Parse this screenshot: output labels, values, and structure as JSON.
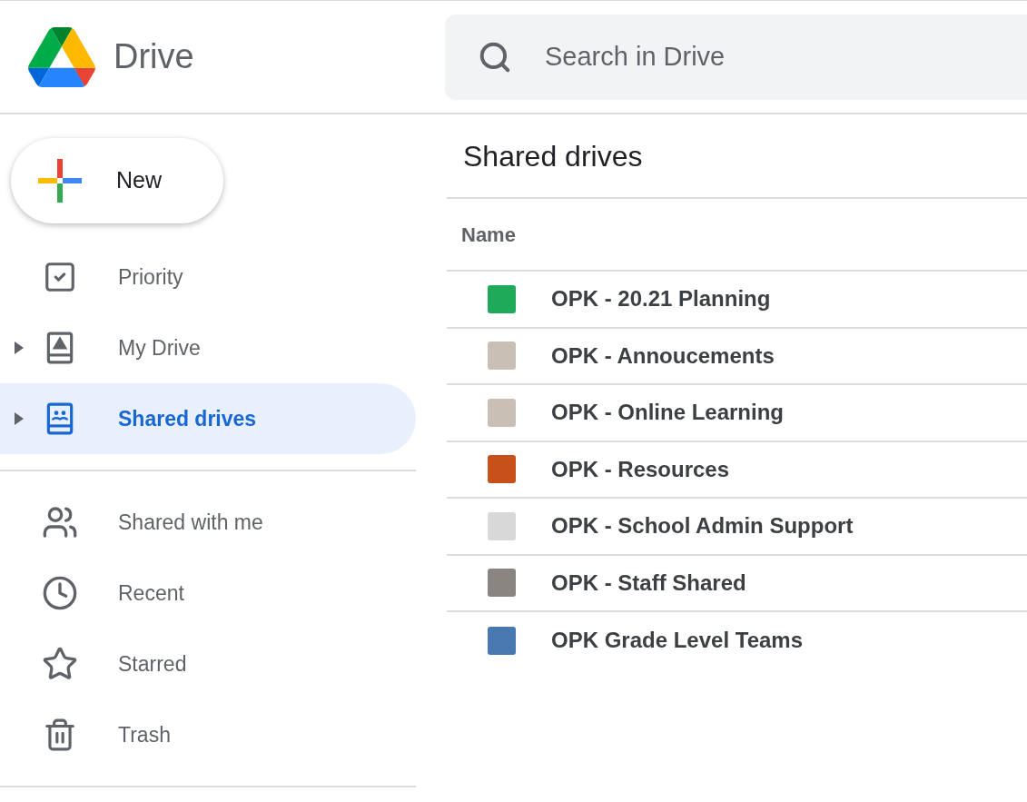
{
  "header": {
    "app_name": "Drive",
    "search": {
      "placeholder": "Search in Drive"
    }
  },
  "sidebar": {
    "new_button": "New",
    "groups": [
      {
        "items": [
          {
            "label": "Priority",
            "selected": false
          },
          {
            "label": "My Drive",
            "selected": false,
            "expanded": false
          },
          {
            "label": "Shared drives",
            "selected": true,
            "expanded": false
          }
        ]
      },
      {
        "items": [
          {
            "label": "Shared with me",
            "selected": false
          },
          {
            "label": "Recent",
            "selected": false
          },
          {
            "label": "Starred",
            "selected": false
          },
          {
            "label": "Trash",
            "selected": false
          }
        ]
      }
    ]
  },
  "main": {
    "title": "Shared drives",
    "table": {
      "columns": [
        "Name"
      ],
      "rows": [
        {
          "name": "OPK - 20.21 Planning",
          "color": "#1faa5a"
        },
        {
          "name": "OPK - Annoucements",
          "color": "#c9bfb5"
        },
        {
          "name": "OPK - Online Learning",
          "color": "#c9bfb5"
        },
        {
          "name": "OPK - Resources",
          "color": "#c8501a"
        },
        {
          "name": "OPK - School Admin Support",
          "color": "#d8d8d8"
        },
        {
          "name": "OPK - Staff Shared",
          "color": "#8a8580"
        },
        {
          "name": "OPK Grade Level Teams",
          "color": "#4a78b0"
        }
      ]
    }
  }
}
